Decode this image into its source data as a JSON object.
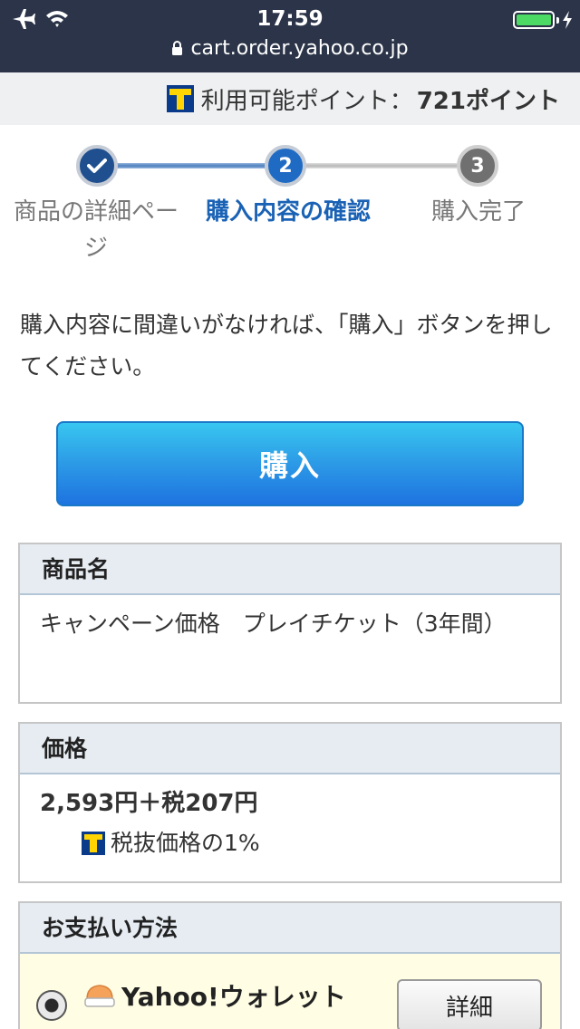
{
  "status_bar": {
    "time": "17:59",
    "url": "cart.order.yahoo.co.jp",
    "battery_level": 1.0,
    "icons": [
      "airplane-icon",
      "wifi-icon",
      "battery-icon",
      "charging-bolt-icon",
      "lock-icon"
    ]
  },
  "points": {
    "label": "利用可能ポイント：",
    "value": "721ポイント"
  },
  "stepper": {
    "current_step": 2,
    "steps": [
      {
        "number": "✓",
        "label": "商品の詳細ページ",
        "state": "done"
      },
      {
        "number": "2",
        "label": "購入内容の確認",
        "state": "current"
      },
      {
        "number": "3",
        "label": "購入完了",
        "state": "pending"
      }
    ]
  },
  "instruction": "購入内容に間違いがなければ、「購入」ボタンを押してください。",
  "buy_button": {
    "label": "購入"
  },
  "product": {
    "header": "商品名",
    "name": "キャンペーン価格　プレイチケット（3年間）"
  },
  "price": {
    "header": "価格",
    "main": "2,593円＋税207円",
    "points_note": "税抜価格の1%"
  },
  "payment": {
    "header": "お支払い方法",
    "method": "Yahoo!ウォレット",
    "detail_button": "詳細",
    "selected": true
  },
  "colors": {
    "status_bar_bg": "#2b3448",
    "accent_blue": "#1a62b5",
    "buy_button_top": "#38c6f0",
    "buy_button_bottom": "#1e73e0",
    "section_header_bg": "#e6ecf2",
    "payment_row_bg": "#fffde3",
    "battery_green": "#4cd964"
  }
}
